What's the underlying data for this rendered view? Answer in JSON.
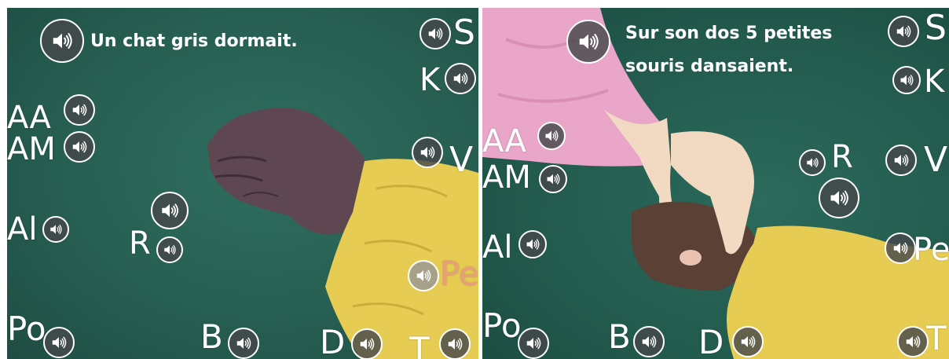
{
  "left": {
    "sentence": "Un chat gris dormait.",
    "labels": {
      "S": "S",
      "K": "K",
      "AA": "AA",
      "AM": "AM",
      "V": "V",
      "Al": "Al",
      "R": "R",
      "Pe": "Pe",
      "Po": "Po",
      "B": "B",
      "D": "D",
      "T": "T"
    }
  },
  "right": {
    "sentence_line1": "Sur son dos 5 petites",
    "sentence_line2": "souris dansaient.",
    "labels": {
      "S": "S",
      "K": "K",
      "AA": "AA",
      "AM": "AM",
      "R": "R",
      "V": "V",
      "Al": "Al",
      "Pe": "Pe",
      "Po": "Po",
      "B": "B",
      "D": "D",
      "T": "T"
    }
  },
  "icons": {
    "speaker": "speaker-icon"
  },
  "colors": {
    "board": "#275f52",
    "sleeve": "#e6cc52",
    "pink_sleeve": "#eaa6c8",
    "highlight_label": "#e8a07a"
  }
}
